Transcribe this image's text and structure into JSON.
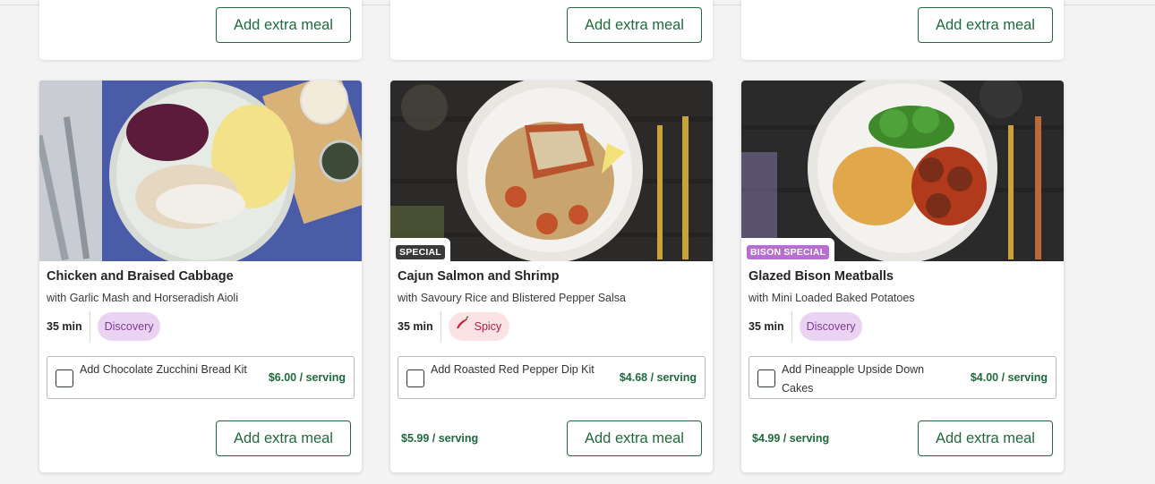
{
  "top_cards": [
    {
      "button_label": "Add extra meal"
    },
    {
      "button_label": "Add extra meal"
    },
    {
      "button_label": "Add extra meal"
    }
  ],
  "recipes": [
    {
      "title": "Chicken and Braised Cabbage",
      "subtitle": "with Garlic Mash and Horseradish Aioli",
      "time": "35 min",
      "chip": "Discovery",
      "chip_icon": "",
      "tag": "",
      "addon_label": "Add Chocolate Zucchini Bread Kit",
      "addon_price": "$6.00 / serving",
      "price": "",
      "button_label": "Add extra meal"
    },
    {
      "title": "Cajun Salmon and Shrimp",
      "subtitle": "with Savoury Rice and Blistered Pepper Salsa",
      "time": "35 min",
      "chip": "Spicy",
      "chip_icon": "chili-pepper-icon",
      "tag": "SPECIAL",
      "addon_label": "Add Roasted Red Pepper Dip Kit",
      "addon_price": "$4.68 / serving",
      "price": "$5.99 / serving",
      "button_label": "Add extra meal"
    },
    {
      "title": "Glazed Bison Meatballs",
      "subtitle": "with Mini Loaded Baked Potatoes",
      "time": "35 min",
      "chip": "Discovery",
      "chip_icon": "",
      "tag": "BISON SPECIAL",
      "addon_label": "Add Pineapple Upside Down Cakes",
      "addon_price": "$4.00 / serving",
      "price": "$4.99 / serving",
      "button_label": "Add extra meal"
    }
  ],
  "colors": {
    "brand_green": "#1f6b3b",
    "discovery_bg": "#ead3f2",
    "discovery_text": "#7a3b96",
    "spicy_bg": "#fbe2e5",
    "special_tag": "#3a3a3a",
    "bison_tag": "#b66ed0"
  }
}
